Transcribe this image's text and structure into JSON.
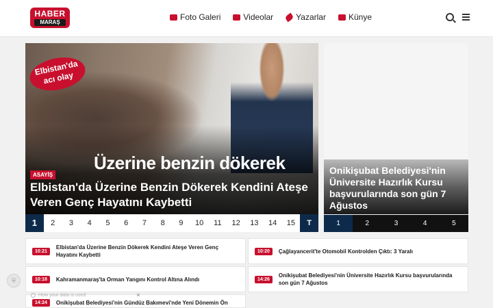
{
  "header": {
    "logo_top": "HABER",
    "logo_bottom": "MARAŞ",
    "nav": [
      {
        "label": "Foto Galeri",
        "icon": "camera-icon"
      },
      {
        "label": "Videolar",
        "icon": "video-icon"
      },
      {
        "label": "Yazarlar",
        "icon": "feather-icon"
      },
      {
        "label": "Künye",
        "icon": "id-card-icon"
      }
    ]
  },
  "hero": {
    "stamp_text": "Elbistan'da acı olay",
    "overlay_title": "Üzerine benzin dökerek",
    "category": "ASAYİŞ",
    "headline": "Elbistan'da Üzerine Benzin Dökerek Kendini Ateşe Veren Genç Hayatını Kaybetti",
    "pages": [
      "1",
      "2",
      "3",
      "4",
      "5",
      "6",
      "7",
      "8",
      "9",
      "10",
      "11",
      "12",
      "13",
      "14",
      "15",
      "T"
    ],
    "active_page": "1"
  },
  "side": {
    "headline": "Onikişubat Belediyesi'nin Üniversite Hazırlık Kursu başvurularında son gün 7 Ağustos",
    "pages": [
      "1",
      "2",
      "3",
      "4",
      "5"
    ],
    "active_page": "1"
  },
  "news": [
    {
      "time": "10:21",
      "text": "Elbistan'da Üzerine Benzin Dökerek Kendini Ateşe Veren Genç Hayatını Kaybetti"
    },
    {
      "time": "10:20",
      "text": "Çağlayancerit'te Otomobil Kontrolden Çıktı: 3 Yaralı"
    },
    {
      "time": "10:18",
      "text": "Kahramanmaraş'ta Orman Yangını Kontrol Altına Alındı"
    },
    {
      "time": "14:26",
      "text": "Onikişubat Belediyesi'nin Üniversite Hazırlık Kursu başvurularında son gün 7 Ağustos"
    },
    {
      "time": "14:24",
      "text": "Onikişubat Belediyesi'nin Gündüz Bakımevi'nde Yeni Dönemin Ön"
    }
  ],
  "privacy": {
    "text": "How your data is used",
    "close": "×"
  },
  "colors": {
    "brand_red": "#c8102e",
    "navy": "#0e2a4a"
  }
}
